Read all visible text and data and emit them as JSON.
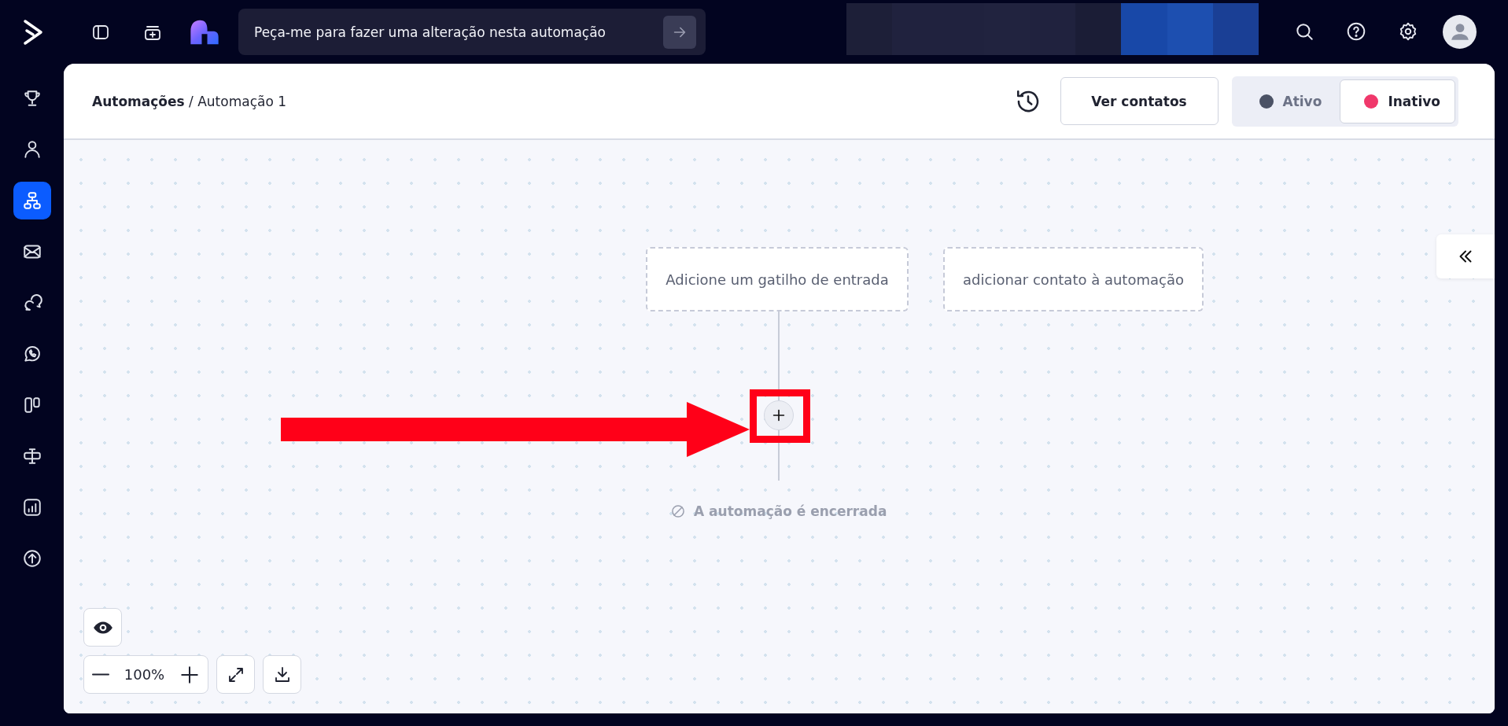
{
  "topbar": {
    "prompt": {
      "placeholder": "Peça-me para fazer uma alteração nesta automação"
    }
  },
  "sidebar": {
    "items": [
      {
        "kind": "trophy",
        "selected": false
      },
      {
        "kind": "person",
        "selected": false
      },
      {
        "kind": "flow",
        "selected": true
      },
      {
        "kind": "mail",
        "selected": false
      },
      {
        "kind": "chat",
        "selected": false
      },
      {
        "kind": "whatsapp",
        "selected": false
      },
      {
        "kind": "board",
        "selected": false
      },
      {
        "kind": "sign",
        "selected": false
      },
      {
        "kind": "report",
        "selected": false
      },
      {
        "kind": "upload",
        "selected": false
      }
    ]
  },
  "header": {
    "breadcrumb": {
      "parent": "Automações",
      "separator": "/",
      "current": "Automação 1"
    },
    "view_contacts_button": "Ver contatos",
    "status_toggle": [
      {
        "label": "Ativo",
        "color": "#4b5265",
        "selected": false
      },
      {
        "label": "Inativo",
        "color": "#f0386b",
        "selected": true
      }
    ]
  },
  "canvas": {
    "nodes": [
      "Adicione um gatilho de entrada",
      "adicionar contato à automação"
    ],
    "end_label": "A automação é encerrada",
    "zoom": "100%"
  }
}
